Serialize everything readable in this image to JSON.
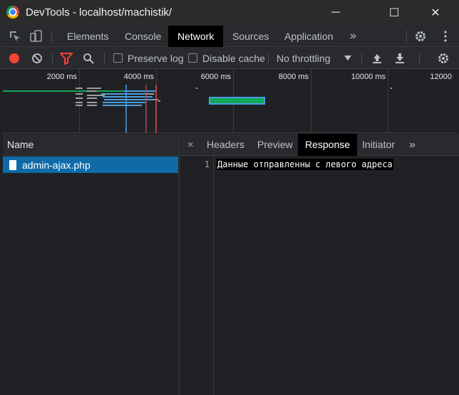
{
  "window": {
    "title": "DevTools - localhost/machistik/",
    "minimize": "─",
    "maximize": "☐",
    "close": "✕"
  },
  "panel_tabs": [
    "Elements",
    "Console",
    "Network",
    "Sources",
    "Application"
  ],
  "panel_more": "»",
  "toolbar": {
    "preserve_log": "Preserve log",
    "disable_cache": "Disable cache",
    "throttling": "No throttling"
  },
  "overview": {
    "ticks": [
      "2000 ms",
      "4000 ms",
      "6000 ms",
      "8000 ms",
      "10000 ms",
      "12000"
    ]
  },
  "requests": {
    "header": "Name",
    "items": [
      {
        "name": "admin-ajax.php"
      }
    ]
  },
  "detail": {
    "close": "×",
    "tabs": [
      "Headers",
      "Preview",
      "Response",
      "Initiator"
    ],
    "more": "»",
    "line_number": "1",
    "response_text": "Данные отправленны с левого адреса"
  },
  "colors": {
    "accent_red": "#f44336",
    "selection_blue": "#0e6ba8",
    "waterfall_green": "#0fa857",
    "waterfall_blue": "#4a9fe0"
  }
}
